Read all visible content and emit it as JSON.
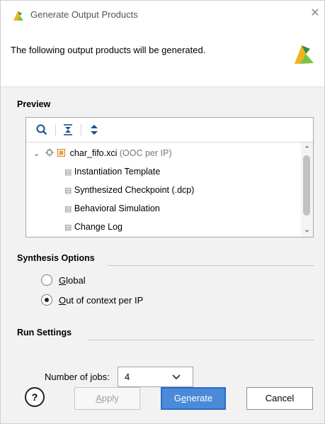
{
  "window": {
    "title": "Generate Output Products",
    "close_icon": "close-icon"
  },
  "header": {
    "message": "The following output products will be generated."
  },
  "preview": {
    "title": "Preview",
    "toolbar": [
      "search-icon",
      "collapse-all-icon",
      "expand-all-icon"
    ],
    "root": {
      "name": "char_fifo.xci",
      "suffix": "(OOC per IP)",
      "expanded": true
    },
    "items": [
      "Instantiation Template",
      "Synthesized Checkpoint (.dcp)",
      "Behavioral Simulation",
      "Change Log"
    ]
  },
  "synthesis": {
    "title": "Synthesis Options",
    "options": [
      {
        "label_pre": "",
        "mnemonic": "G",
        "label_post": "lobal",
        "selected": false
      },
      {
        "label_pre": "",
        "mnemonic": "O",
        "label_post": "ut of context per IP",
        "selected": true
      }
    ]
  },
  "run": {
    "title": "Run Settings",
    "jobs_label_pre": "Number of ",
    "jobs_mnemonic": "j",
    "jobs_label_post": "obs:",
    "jobs_value": "4"
  },
  "buttons": {
    "help": "?",
    "apply_mnemonic": "A",
    "apply_rest": "pply",
    "generate_pre": "G",
    "generate_mnemonic": "e",
    "generate_post": "nerate",
    "cancel": "Cancel"
  },
  "colors": {
    "accent": "#4b8ad8",
    "ip_icon": "#f0a030",
    "logo_green": "#7cc242",
    "logo_orange": "#f4b221"
  }
}
